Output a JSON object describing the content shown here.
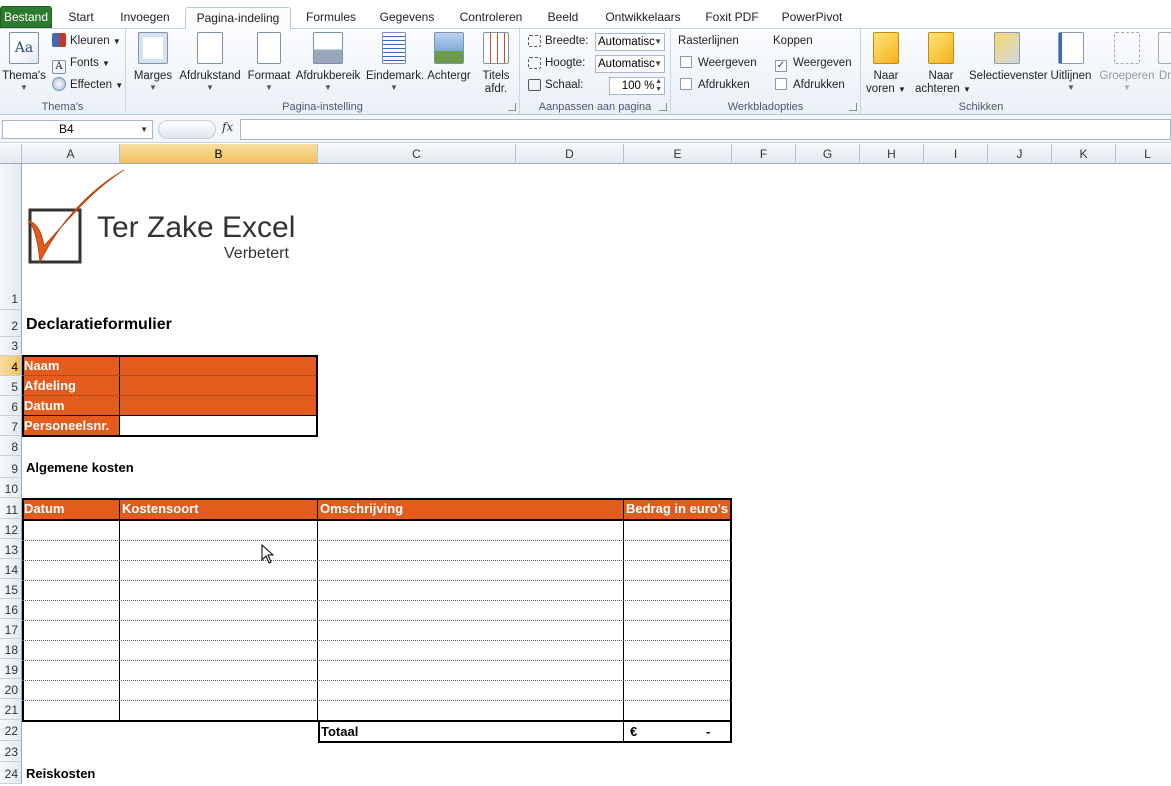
{
  "tabs": [
    "Bestand",
    "Start",
    "Invoegen",
    "Pagina-indeling",
    "Formules",
    "Gegevens",
    "Controleren",
    "Beeld",
    "Ontwikkelaars",
    "Foxit PDF",
    "PowerPivot"
  ],
  "ribbon": {
    "themas": {
      "label": "Thema's",
      "button": "Thema's",
      "kleuren": "Kleuren",
      "fonts": "Fonts",
      "effecten": "Effecten"
    },
    "pagina": {
      "label": "Pagina-instelling",
      "marges": "Marges",
      "afdrukstand": "Afdrukstand",
      "formaat": "Formaat",
      "afdrukbereik": "Afdrukbereik",
      "eindemark": "Eindemark.",
      "achtergr": "Achtergr",
      "titels_1": "Titels",
      "titels_2": "afdr."
    },
    "aanpassen": {
      "label": "Aanpassen aan pagina",
      "breedte_label": "Breedte:",
      "breedte_value": "Automatisc",
      "hoogte_label": "Hoogte:",
      "hoogte_value": "Automatisc",
      "schaal_label": "Schaal:",
      "schaal_value": "100 %"
    },
    "werkblad": {
      "label": "Werkbladopties",
      "raster": "Rasterlijnen",
      "koppen": "Koppen",
      "weergeven": "Weergeven",
      "afdrukken": "Afdrukken"
    },
    "schikken": {
      "label": "Schikken",
      "naar_voren_1": "Naar",
      "naar_voren_2": "voren",
      "naar_achteren_1": "Naar",
      "naar_achteren_2": "achteren",
      "selectievenster": "Selectievenster",
      "uitlijnen": "Uitlijnen",
      "groeperen": "Groeperen",
      "draaien": "Dr"
    }
  },
  "formula": {
    "namebox": "B4",
    "fx": "fx",
    "value": ""
  },
  "columns": [
    "A",
    "B",
    "C",
    "D",
    "E",
    "F",
    "G",
    "H",
    "I",
    "J",
    "K",
    "L"
  ],
  "rows": [
    "1",
    "2",
    "3",
    "4",
    "5",
    "6",
    "7",
    "8",
    "9",
    "10",
    "11",
    "12",
    "13",
    "14",
    "15",
    "16",
    "17",
    "18",
    "19",
    "20",
    "21",
    "22",
    "23",
    "24"
  ],
  "sheet": {
    "logo_title": "Ter Zake Excel",
    "logo_sub": "Verbetert",
    "title": "Declaratieformulier",
    "fields": [
      "Naam",
      "Afdeling",
      "Datum",
      "Personeelsnr."
    ],
    "section1": "Algemene kosten",
    "table_headers": [
      "Datum",
      "Kostensoort",
      "Omschrijving",
      "Bedrag in euro's"
    ],
    "totaal": "Totaal",
    "euro": "€",
    "total_value": "-",
    "section2": "Reiskosten"
  },
  "colors": {
    "accent": "#e35b1d",
    "file_tab": "#2c7a2c",
    "selection": "#f1c15f"
  }
}
